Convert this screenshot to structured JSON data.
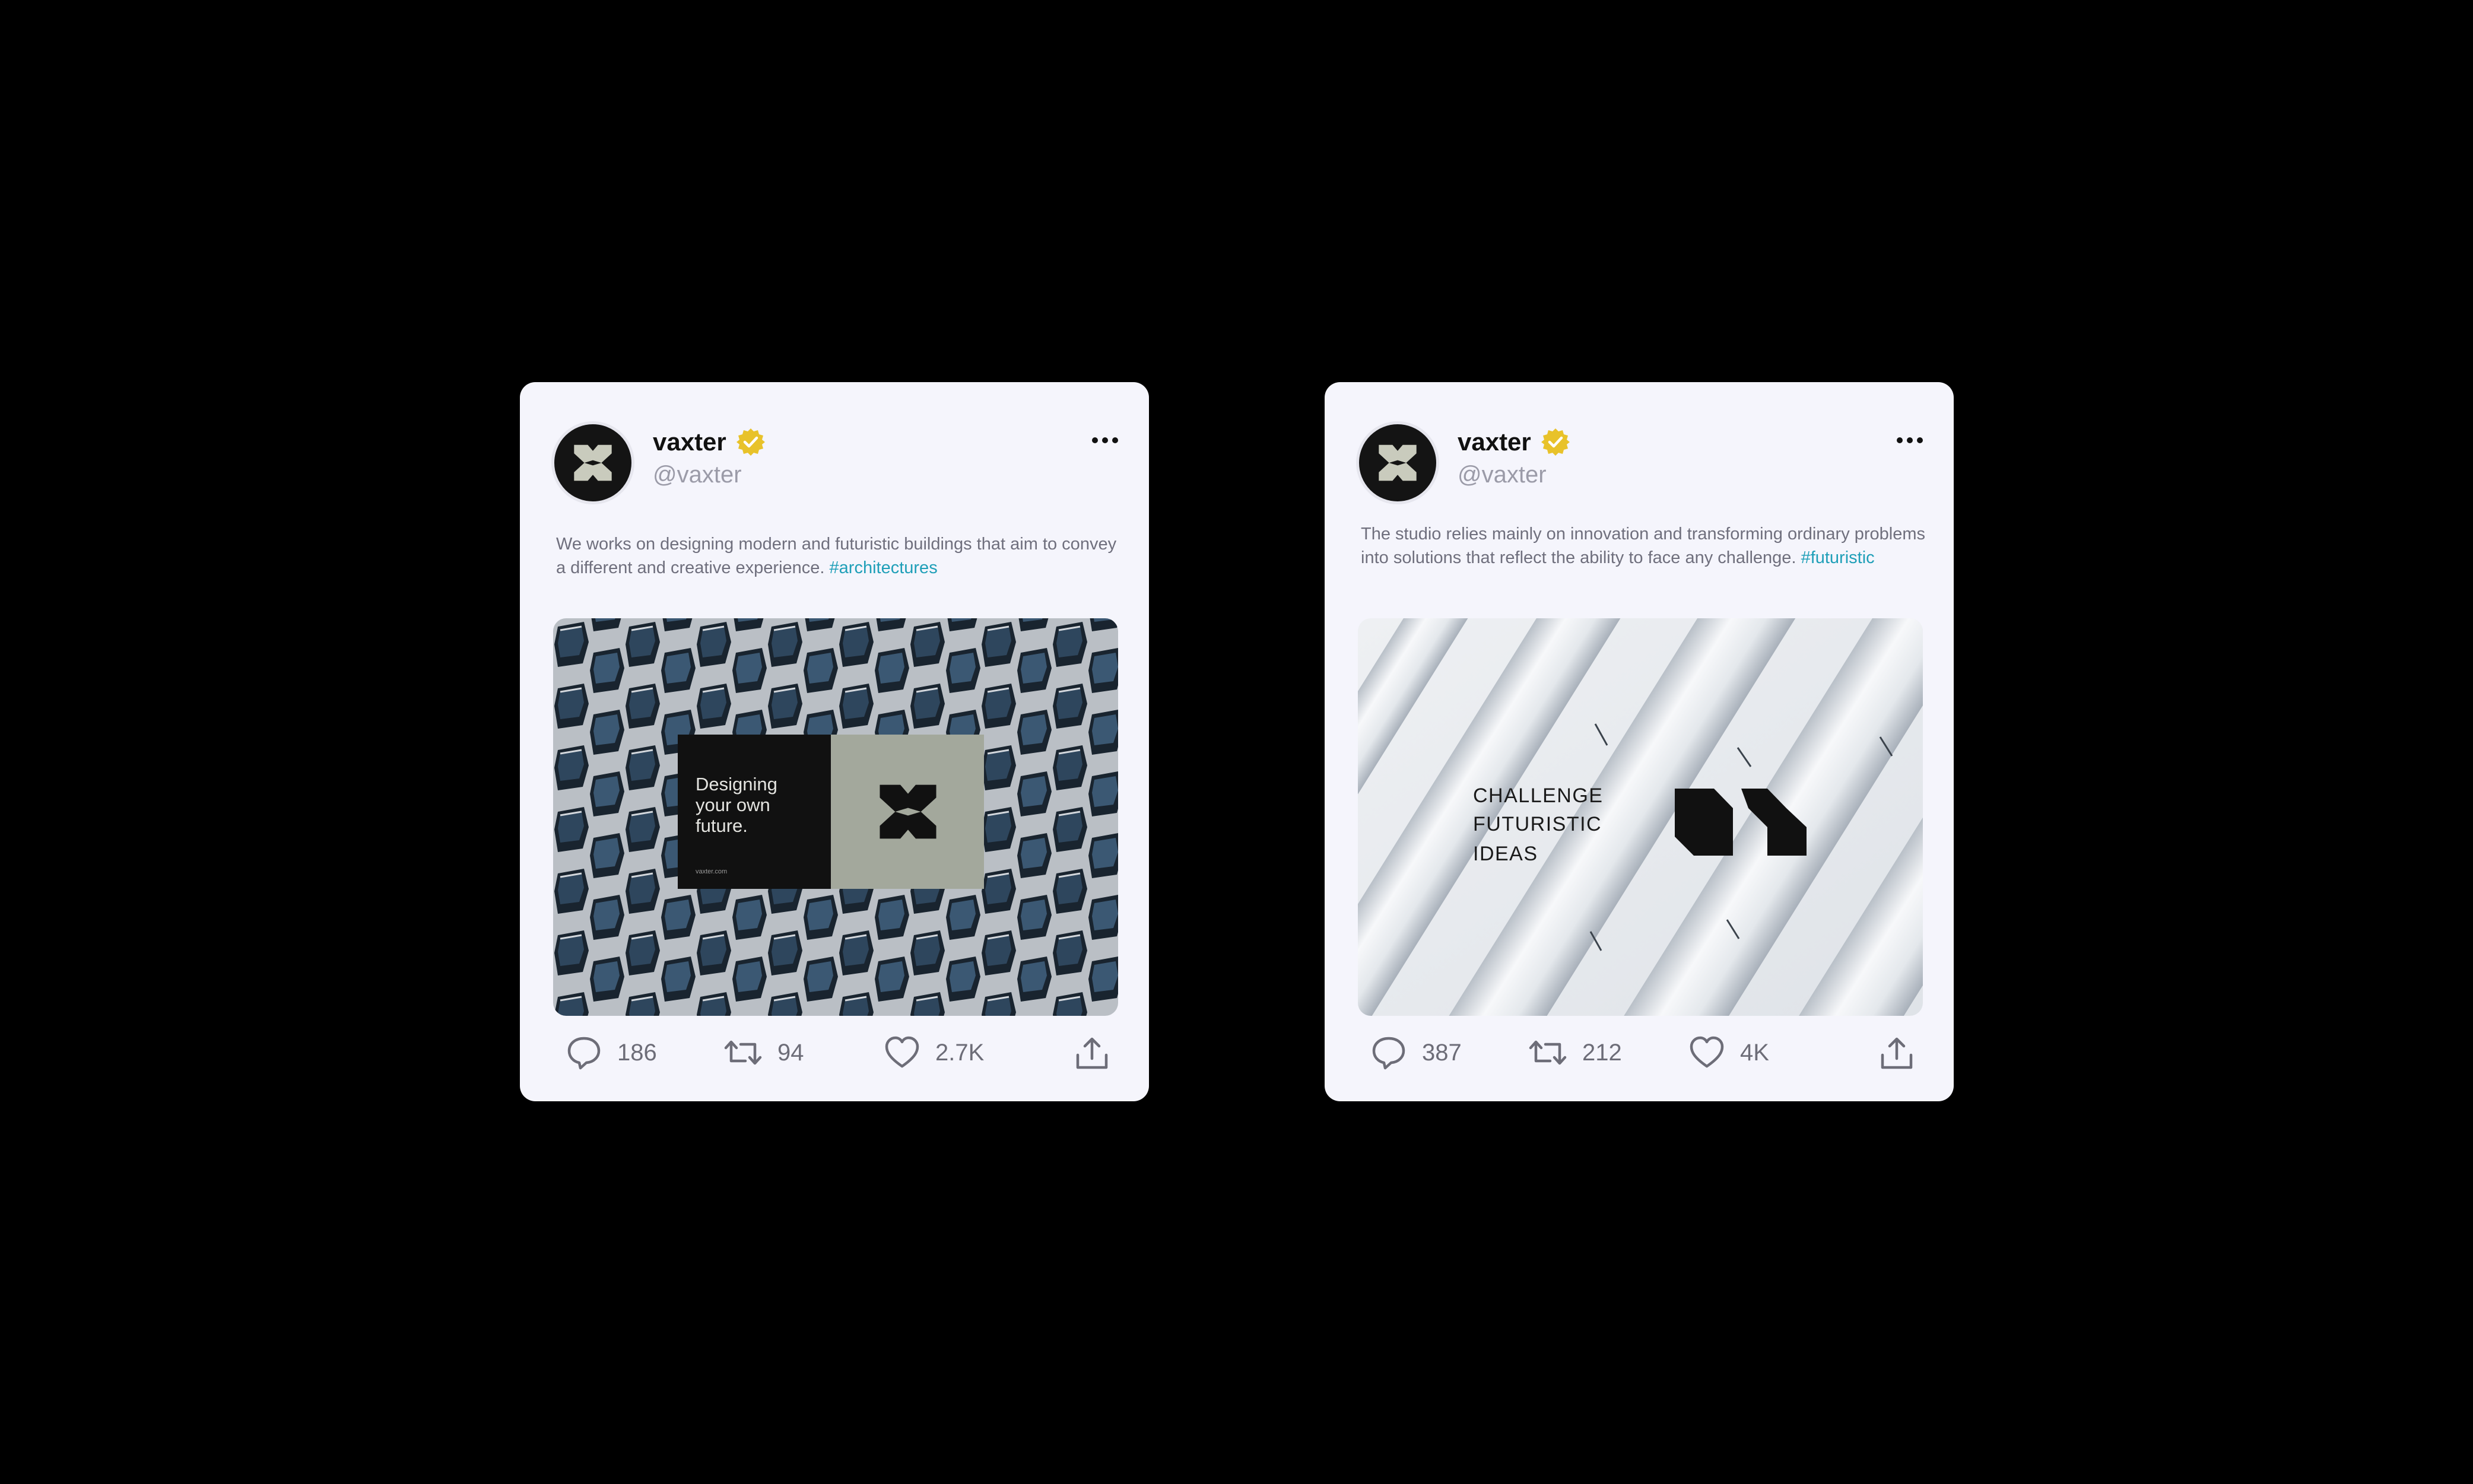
{
  "colors": {
    "background": "#000000",
    "card": "#f5f5fc",
    "hashtag": "#1f9fb8",
    "verified": "#e8c22a"
  },
  "posts": [
    {
      "author": {
        "name": "vaxter",
        "handle": "@vaxter",
        "verified": true
      },
      "text": "We works on designing modern and futuristic buildings that aim to convey a different and creative experience.",
      "hashtag": "#architectures",
      "image": {
        "description_icon": "honeycomb-facade-photo",
        "tagline": [
          "Designing",
          "your own",
          "future."
        ],
        "site": "vaxter.com"
      },
      "stats": {
        "comments": "186",
        "reposts": "94",
        "likes": "2.7K"
      }
    },
    {
      "author": {
        "name": "vaxter",
        "handle": "@vaxter",
        "verified": true
      },
      "text": "The studio relies mainly on innovation and transforming ordinary problems into solutions that reflect the ability to face any challenge.",
      "hashtag": "#futuristic",
      "image": {
        "description_icon": "white-pipes-photo",
        "headline": [
          "CHALLENGE",
          "FUTURISTIC",
          "IDEAS"
        ]
      },
      "stats": {
        "comments": "387",
        "reposts": "212",
        "likes": "4K"
      }
    }
  ]
}
